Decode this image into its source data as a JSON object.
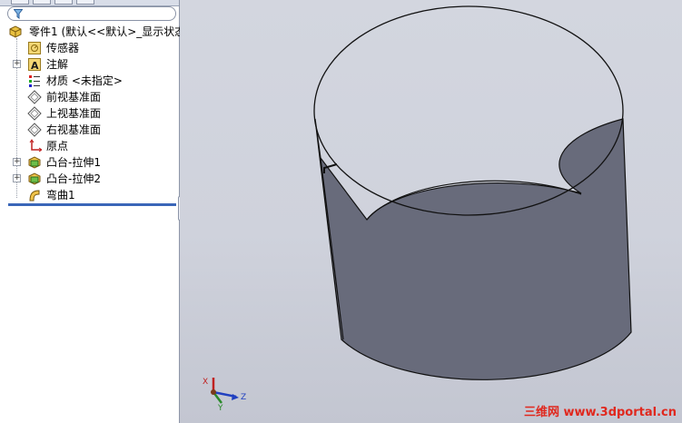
{
  "feature_tree": {
    "root": {
      "label": "零件1   (默认<<默认>_显示状态"
    },
    "items": [
      {
        "label": "传感器",
        "icon": "sensor-icon",
        "expandable": false
      },
      {
        "label": "注解",
        "icon": "annotation-icon",
        "expandable": true
      },
      {
        "label": "材质 <未指定>",
        "icon": "material-icon",
        "expandable": false
      },
      {
        "label": "前视基准面",
        "icon": "plane-icon",
        "expandable": false
      },
      {
        "label": "上视基准面",
        "icon": "plane-icon",
        "expandable": false
      },
      {
        "label": "右视基准面",
        "icon": "plane-icon",
        "expandable": false
      },
      {
        "label": "原点",
        "icon": "origin-icon",
        "expandable": false
      },
      {
        "label": "凸台-拉伸1",
        "icon": "boss-extrude-icon",
        "expandable": true
      },
      {
        "label": "凸台-拉伸2",
        "icon": "boss-extrude-icon",
        "expandable": true
      },
      {
        "label": "弯曲1",
        "icon": "flex-icon",
        "expandable": false
      }
    ]
  },
  "triad": {
    "x_label": "X",
    "y_label": "Y",
    "z_label": "Z"
  },
  "watermark": "三维网 www.3dportal.cn",
  "colors": {
    "viewport_bg": "#cfd2dc",
    "model_face": "#6b6e7e",
    "rollback_bar": "#3a66b8",
    "watermark": "#e0281e"
  }
}
